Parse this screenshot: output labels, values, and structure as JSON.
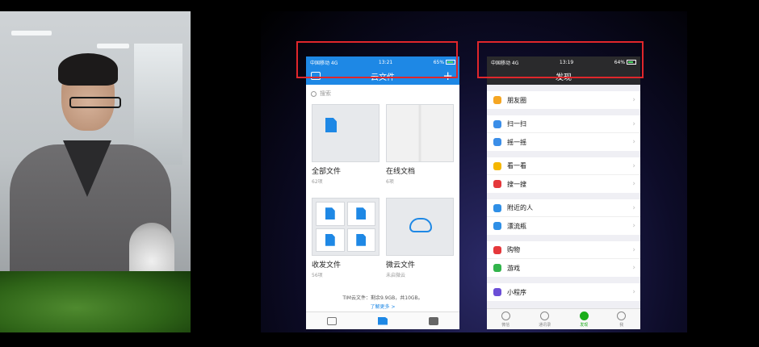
{
  "colors": {
    "tim_blue": "#1e88e5",
    "wechat_dark": "#2a2a2c",
    "wechat_green": "#1aad19",
    "highlight_red": "#e0262b"
  },
  "left_phone": {
    "status": {
      "carrier": "中国移动 4G",
      "time": "13:21",
      "battery": "65%"
    },
    "nav": {
      "title": "云文件",
      "left_icon": "folder-upload-icon",
      "right_icon": "plus-icon"
    },
    "search": {
      "placeholder": "搜索"
    },
    "tiles": [
      {
        "name": "全部文件",
        "sub": "62项",
        "icon": "document-icon"
      },
      {
        "name": "在线文档",
        "sub": "6项",
        "icon": "docs-icon"
      },
      {
        "name": "收发文件",
        "sub": "56项",
        "icon": "document-grid-icon"
      },
      {
        "name": "微云文件",
        "sub": "未启微云",
        "icon": "cloud-icon"
      }
    ],
    "storage": {
      "text": "TIM云文件：剩余9.9GB，共10GB。",
      "more": "了解更多 >"
    },
    "tabbar": {
      "icons": [
        "message-icon",
        "cloud-file-icon",
        "briefcase-icon"
      ]
    }
  },
  "right_phone": {
    "status": {
      "carrier": "中国移动 4G",
      "time": "13:19",
      "battery": "64%"
    },
    "nav": {
      "title": "发现"
    },
    "groups": [
      [
        {
          "label": "朋友圈",
          "icon": "moments-icon",
          "color": "#f5a623"
        }
      ],
      [
        {
          "label": "扫一扫",
          "icon": "scan-icon",
          "color": "#3b8ee8"
        },
        {
          "label": "摇一摇",
          "icon": "shake-icon",
          "color": "#3b8ee8"
        }
      ],
      [
        {
          "label": "看一看",
          "icon": "look-icon",
          "color": "#f5b700"
        },
        {
          "label": "搜一搜",
          "icon": "search-icon",
          "color": "#e5383b"
        }
      ],
      [
        {
          "label": "附近的人",
          "icon": "nearby-icon",
          "color": "#2f8fe6"
        },
        {
          "label": "漂流瓶",
          "icon": "bottle-icon",
          "color": "#2f8fe6"
        }
      ],
      [
        {
          "label": "购物",
          "icon": "shopping-icon",
          "color": "#e5383b"
        },
        {
          "label": "游戏",
          "icon": "games-icon",
          "color": "#31b44b"
        }
      ],
      [
        {
          "label": "小程序",
          "icon": "mini-program-icon",
          "color": "#6b4ed6"
        }
      ]
    ],
    "tabbar": [
      {
        "label": "微信",
        "icon": "chat-icon",
        "active": false
      },
      {
        "label": "通讯录",
        "icon": "contacts-icon",
        "active": false
      },
      {
        "label": "发现",
        "icon": "discover-icon",
        "active": true
      },
      {
        "label": "我",
        "icon": "me-icon",
        "active": false
      }
    ]
  }
}
